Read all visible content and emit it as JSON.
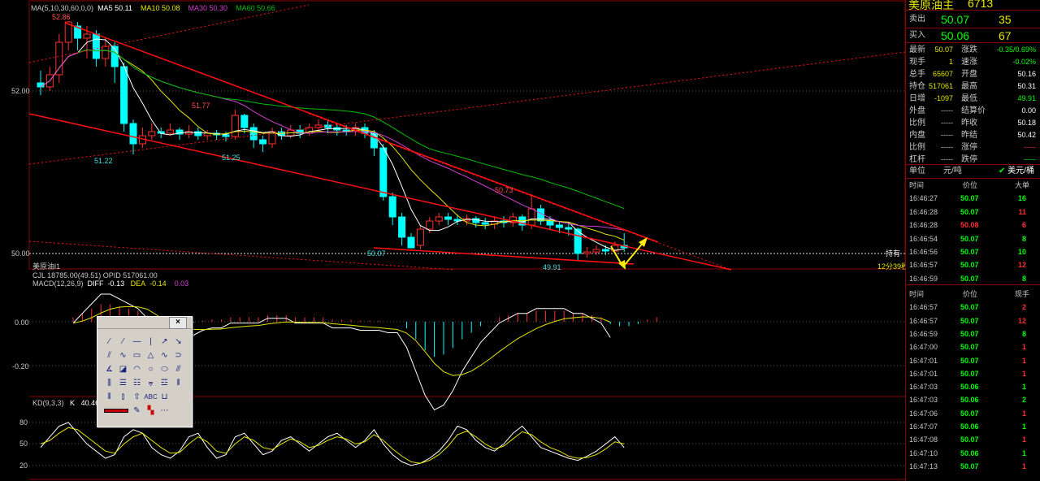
{
  "instrument": {
    "name": "美原油主",
    "code": "6713"
  },
  "quote": {
    "sell": {
      "label": "卖出",
      "price": "50.07",
      "vol": "35"
    },
    "buy": {
      "label": "买入",
      "price": "50.06",
      "vol": "67"
    },
    "rows": [
      {
        "l1": "最新",
        "v1": "50.07",
        "l2": "涨跌",
        "v2": "-0.35/0.69%"
      },
      {
        "l1": "现手",
        "v1": "1",
        "l2": "速涨",
        "v2": "-0.02%"
      },
      {
        "l1": "总手",
        "v1": "65607",
        "l2": "开盘",
        "v2": "50.16"
      },
      {
        "l1": "持仓",
        "v1": "517061",
        "l2": "最高",
        "v2": "50.31"
      },
      {
        "l1": "日增",
        "v1": "-1097",
        "l2": "最低",
        "v2": "49.91"
      },
      {
        "l1": "外盘",
        "v1": "-----",
        "l2": "结算价",
        "v2": "0.00"
      },
      {
        "l1": "比例",
        "v1": "-----",
        "l2": "昨收",
        "v2": "50.18"
      },
      {
        "l1": "内盘",
        "v1": "-----",
        "l2": "昨结",
        "v2": "50.42"
      },
      {
        "l1": "比例",
        "v1": "-----",
        "l2": "涨停",
        "v2": "-----"
      },
      {
        "l1": "杠杆",
        "v1": "-----",
        "l2": "跌停",
        "v2": "-----"
      }
    ],
    "unit_label": "单位",
    "unit_value": "元/吨",
    "unit_opt": "美元/桶"
  },
  "big_orders": {
    "headers": [
      "时间",
      "价位",
      "大单"
    ],
    "rows": [
      [
        "16:46:27",
        "50.07",
        "16"
      ],
      [
        "16:46:28",
        "50.07",
        "11"
      ],
      [
        "16:46:28",
        "50.08",
        "6"
      ],
      [
        "16:46:54",
        "50.07",
        "8"
      ],
      [
        "16:46:56",
        "50.07",
        "10"
      ],
      [
        "16:46:57",
        "50.07",
        "12"
      ],
      [
        "16:46:59",
        "50.07",
        "8"
      ]
    ]
  },
  "ticks": {
    "headers": [
      "时间",
      "价位",
      "现手"
    ],
    "rows": [
      [
        "16:46:57",
        "50.07",
        "2"
      ],
      [
        "16:46:57",
        "50.07",
        "12"
      ],
      [
        "16:46:59",
        "50.07",
        "8"
      ],
      [
        "16:47:00",
        "50.07",
        "1"
      ],
      [
        "16:47:01",
        "50.07",
        "1"
      ],
      [
        "16:47:01",
        "50.07",
        "1"
      ],
      [
        "16:47:03",
        "50.06",
        "1"
      ],
      [
        "16:47:03",
        "50.06",
        "2"
      ],
      [
        "16:47:06",
        "50.07",
        "1"
      ],
      [
        "16:47:07",
        "50.06",
        "1"
      ],
      [
        "16:47:08",
        "50.07",
        "1"
      ],
      [
        "16:47:10",
        "50.06",
        "1"
      ],
      [
        "16:47:13",
        "50.07",
        "1"
      ]
    ]
  },
  "legends": {
    "ma": [
      {
        "text": "MA(5,10,30,60,0,0)",
        "color": "#c8c8c8"
      },
      {
        "text": "MA5 50.11",
        "color": "#ffffff"
      },
      {
        "text": "MA10 50.08",
        "color": "#e6e600"
      },
      {
        "text": "MA30 50.30",
        "color": "#d040d0"
      },
      {
        "text": "MA60 50.66",
        "color": "#00c000"
      }
    ],
    "cjl": "CJL  18785.00(49.51)    OPID    517061.00",
    "macd": {
      "name": "MACD(12,26,9)",
      "diff_label": "DIFF",
      "diff": "-0.13",
      "dea_label": "DEA",
      "dea": "-0.14",
      "macd": "0.03"
    },
    "kd": {
      "name": "KD(9,3,3)",
      "k_label": "K",
      "k": "40.46"
    },
    "market_tag": "美原油l1",
    "hold_label": "持有",
    "countdown": "12分39秒"
  },
  "price_labels": {
    "high": "52.86",
    "p2": "51.77",
    "low1": "51.22",
    "low2": "51.25",
    "p5": "50.73",
    "low3": "50.07",
    "low4": "49.91"
  },
  "axis_labels": {
    "price": [
      "52.00",
      "50.00"
    ],
    "macd": [
      "0.00",
      "-0.20"
    ],
    "kd": [
      "80",
      "50",
      "20"
    ]
  },
  "colors": {
    "up": "#ff3030",
    "down": "#00ffff",
    "trend": "#ff1010",
    "ma5": "#ffffff",
    "ma10": "#e6e600",
    "ma30": "#d040d0",
    "ma60": "#00c000",
    "arrow": "#ffee00"
  },
  "toolbox": {
    "close": "×",
    "abc": "ABC"
  },
  "chart_data": {
    "type": "candlestick",
    "ylim": [
      49.8,
      53.0
    ],
    "candles": [
      [
        52.1,
        52.05,
        52.25,
        51.95
      ],
      [
        52.05,
        52.2,
        52.3,
        52.0
      ],
      [
        52.2,
        52.6,
        52.7,
        52.1
      ],
      [
        52.6,
        52.85,
        52.86,
        52.5
      ],
      [
        52.8,
        52.65,
        52.85,
        52.5
      ],
      [
        52.65,
        52.7,
        52.8,
        52.4
      ],
      [
        52.7,
        52.4,
        52.75,
        52.3
      ],
      [
        52.4,
        52.55,
        52.65,
        52.3
      ],
      [
        52.55,
        52.3,
        52.6,
        52.1
      ],
      [
        52.3,
        51.6,
        52.35,
        51.5
      ],
      [
        51.6,
        51.35,
        51.65,
        51.22
      ],
      [
        51.35,
        51.45,
        51.55,
        51.3
      ],
      [
        51.45,
        51.5,
        51.6,
        51.4
      ],
      [
        51.5,
        51.48,
        51.55,
        51.42
      ],
      [
        51.48,
        51.52,
        51.6,
        51.45
      ],
      [
        51.52,
        51.47,
        51.55,
        51.4
      ],
      [
        51.47,
        51.5,
        51.58,
        51.42
      ],
      [
        51.5,
        51.45,
        51.55,
        51.4
      ],
      [
        51.45,
        51.48,
        51.52,
        51.4
      ],
      [
        51.48,
        51.46,
        51.52,
        51.4
      ],
      [
        51.46,
        51.44,
        51.5,
        51.38
      ],
      [
        51.44,
        51.7,
        51.77,
        51.4
      ],
      [
        51.7,
        51.55,
        51.72,
        51.48
      ],
      [
        51.55,
        51.4,
        51.6,
        51.3
      ],
      [
        51.4,
        51.35,
        51.45,
        51.25
      ],
      [
        51.35,
        51.5,
        51.55,
        51.3
      ],
      [
        51.5,
        51.45,
        51.55,
        51.4
      ],
      [
        51.45,
        51.52,
        51.58,
        51.42
      ],
      [
        51.52,
        51.48,
        51.58,
        51.42
      ],
      [
        51.48,
        51.55,
        51.6,
        51.45
      ],
      [
        51.55,
        51.58,
        51.65,
        51.5
      ],
      [
        51.58,
        51.55,
        51.65,
        51.48
      ],
      [
        51.55,
        51.52,
        51.6,
        51.45
      ],
      [
        51.52,
        51.5,
        51.58,
        51.45
      ],
      [
        51.5,
        51.55,
        51.6,
        51.45
      ],
      [
        51.55,
        51.48,
        51.6,
        51.42
      ],
      [
        51.48,
        51.3,
        51.52,
        51.2
      ],
      [
        51.3,
        50.7,
        51.35,
        50.65
      ],
      [
        50.7,
        50.45,
        50.75,
        50.35
      ],
      [
        50.45,
        50.2,
        50.5,
        50.1
      ],
      [
        50.2,
        50.07,
        50.25,
        50.07
      ],
      [
        50.1,
        50.3,
        50.35,
        50.05
      ],
      [
        50.3,
        50.4,
        50.45,
        50.25
      ],
      [
        50.4,
        50.45,
        50.5,
        50.35
      ],
      [
        50.45,
        50.42,
        50.5,
        50.35
      ],
      [
        50.42,
        50.4,
        50.48,
        50.35
      ],
      [
        50.4,
        50.43,
        50.48,
        50.35
      ],
      [
        50.43,
        50.38,
        50.46,
        50.32
      ],
      [
        50.38,
        50.36,
        50.44,
        50.3
      ],
      [
        50.36,
        50.4,
        50.46,
        50.3
      ],
      [
        50.4,
        50.38,
        50.46,
        50.32
      ],
      [
        50.38,
        50.45,
        50.5,
        50.33
      ],
      [
        50.45,
        50.35,
        50.48,
        50.28
      ],
      [
        50.35,
        50.55,
        50.73,
        50.3
      ],
      [
        50.55,
        50.4,
        50.6,
        50.35
      ],
      [
        50.4,
        50.35,
        50.46,
        50.3
      ],
      [
        50.35,
        50.32,
        50.4,
        50.25
      ],
      [
        50.32,
        50.3,
        50.38,
        50.22
      ],
      [
        50.3,
        50.0,
        50.32,
        49.91
      ],
      [
        50.0,
        50.02,
        50.08,
        49.95
      ],
      [
        50.02,
        50.05,
        50.1,
        49.98
      ],
      [
        50.05,
        50.03,
        50.1,
        49.98
      ],
      [
        50.03,
        50.1,
        50.15,
        50.0
      ],
      [
        50.1,
        50.07,
        50.25,
        50.02
      ]
    ],
    "macd_hist": [
      0.02,
      0.04,
      0.06,
      0.08,
      0.08,
      0.07,
      0.06,
      0.05,
      0.03,
      -0.01,
      -0.03,
      -0.02,
      -0.01,
      -0.005,
      0.005,
      0.01,
      0.01,
      0.02,
      0.02,
      0.02,
      0.02,
      0.03,
      0.03,
      0.03,
      0.02,
      0.02,
      0.02,
      0.02,
      0.01,
      0.01,
      0.01,
      0.005,
      0.005,
      0.005,
      0.0,
      0.0,
      -0.03,
      -0.08,
      -0.13,
      -0.16,
      -0.15,
      -0.12,
      -0.08,
      -0.05,
      -0.02,
      0.0,
      0.02,
      0.03,
      0.04,
      0.04,
      0.05,
      0.05,
      0.05,
      0.05,
      0.04,
      0.04,
      0.03,
      0.02,
      -0.01,
      -0.02,
      -0.02,
      -0.01,
      0.01,
      0.02
    ],
    "kd_k": [
      40,
      55,
      70,
      75,
      60,
      45,
      35,
      25,
      30,
      55,
      65,
      60,
      40,
      30,
      25,
      35,
      55,
      60,
      40,
      25,
      30,
      55,
      60,
      45,
      30,
      35,
      50,
      55,
      45,
      35,
      45,
      55,
      60,
      50,
      40,
      50,
      65,
      45,
      30,
      20,
      15,
      18,
      25,
      35,
      50,
      70,
      65,
      50,
      40,
      35,
      45,
      60,
      70,
      55,
      40,
      35,
      30,
      25,
      22,
      28,
      35,
      45,
      55,
      40
    ],
    "kd_d": [
      45,
      50,
      60,
      68,
      65,
      55,
      45,
      35,
      32,
      45,
      55,
      60,
      50,
      40,
      32,
      33,
      45,
      55,
      48,
      35,
      32,
      45,
      55,
      50,
      40,
      37,
      45,
      52,
      48,
      40,
      43,
      50,
      55,
      52,
      45,
      48,
      58,
      50,
      38,
      28,
      20,
      18,
      22,
      30,
      42,
      58,
      63,
      55,
      45,
      38,
      42,
      52,
      62,
      58,
      48,
      40,
      35,
      28,
      25,
      26,
      30,
      38,
      48,
      45
    ]
  }
}
